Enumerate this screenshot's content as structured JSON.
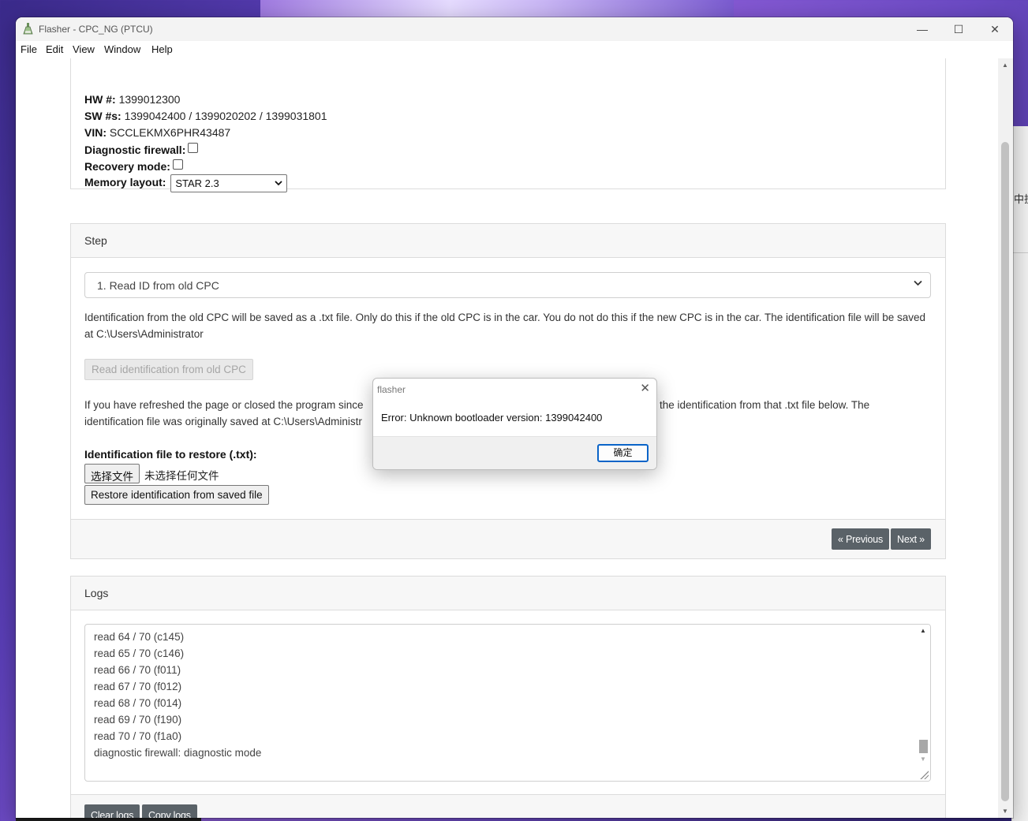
{
  "window": {
    "title": "Flasher - CPC_NG (PTCU)",
    "controls": {
      "minimize": "—",
      "maximize": "☐",
      "close": "✕"
    }
  },
  "menu": [
    "File",
    "Edit",
    "View",
    "Window",
    "Help"
  ],
  "info": {
    "hw_label": "HW #:",
    "hw_value": "1399012300",
    "sw_label": "SW #s:",
    "sw_value": "1399042400 / 1399020202 / 1399031801",
    "vin_label": "VIN:",
    "vin_value": "SCCLEKMX6PHR43487",
    "firewall_label": "Diagnostic firewall:",
    "firewall_checked": false,
    "recovery_label": "Recovery mode:",
    "recovery_checked": false,
    "memory_label": "Memory layout:",
    "memory_value": "STAR 2.3"
  },
  "step": {
    "header": "Step",
    "selected": "1. Read ID from old CPC",
    "description": "Identification from the old CPC will be saved as a .txt file. Only do this if the old CPC is in the car. You do not do this if the new CPC is in the car. The identification file will be saved at C:\\Users\\Administrator",
    "read_button": "Read identification from old CPC",
    "restore_para_line1_left": "If you have refreshed the page or closed the program since",
    "restore_para_line1_right": "the identification from that .txt file below. The",
    "restore_para_line2": "identification file was originally saved at C:\\Users\\Administr",
    "file_label": "Identification file to restore (.txt):",
    "choose_file_button": "选择文件",
    "no_file_text": "未选择任何文件",
    "restore_button": "Restore identification from saved file",
    "previous_button": "« Previous",
    "next_button": "Next »"
  },
  "logs": {
    "header": "Logs",
    "lines": [
      "read 64 / 70 (c145)",
      "read 65 / 70 (c146)",
      "read 66 / 70 (f011)",
      "read 67 / 70 (f012)",
      "read 68 / 70 (f014)",
      "read 69 / 70 (f190)",
      "read 70 / 70 (f1a0)",
      "diagnostic firewall: diagnostic mode"
    ],
    "clear_button": "Clear logs",
    "copy_button": "Copy logs"
  },
  "dialog": {
    "title": "flasher",
    "message": "Error: Unknown bootloader version: 1399042400",
    "ok_button": "确定"
  },
  "background": {
    "side_window_text": "中投"
  },
  "colors": {
    "dark_button": "#5a6268",
    "dialog_focus": "#0a64c8"
  }
}
